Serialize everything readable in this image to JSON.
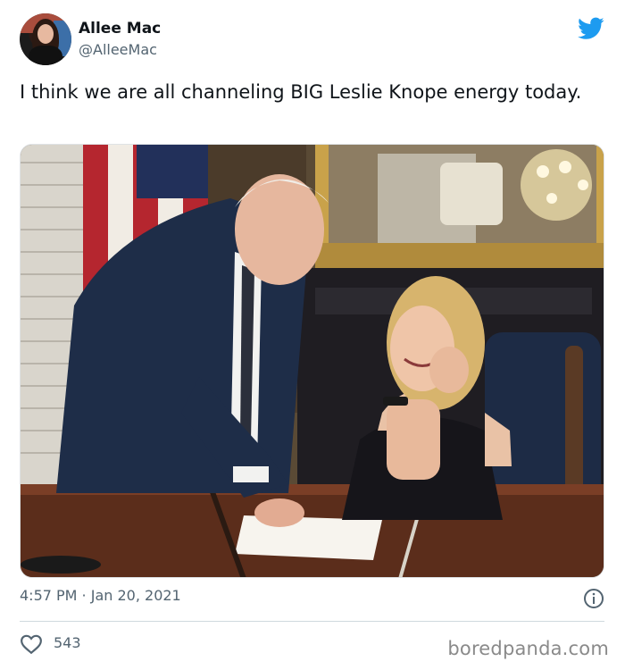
{
  "author": {
    "name": "Allee Mac",
    "handle": "@AlleeMac"
  },
  "tweet": {
    "text": "I think we are all channeling BIG Leslie Knope energy today.",
    "timestamp": "4:57 PM · Jan 20, 2021",
    "likes": "543"
  },
  "icons": {
    "brand": "twitter-bird-icon",
    "info": "info-icon",
    "like": "heart-icon"
  },
  "colors": {
    "twitter_blue": "#1d9bf0",
    "secondary_text": "#536471"
  },
  "watermark": "boredpanda.com"
}
